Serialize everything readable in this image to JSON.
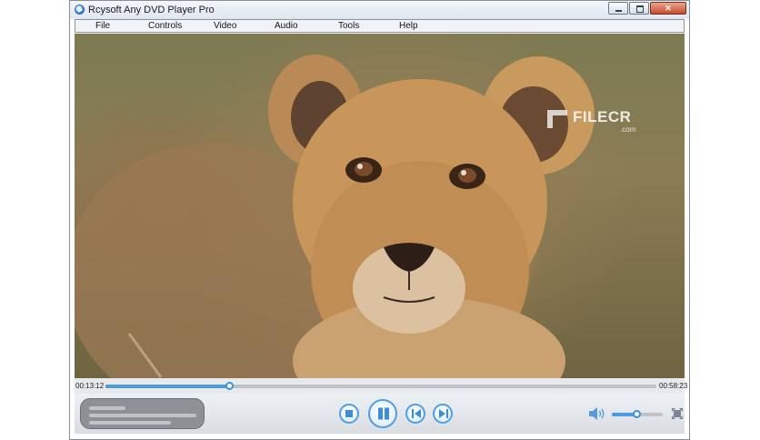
{
  "window": {
    "title": "Rcysoft Any DVD Player Pro"
  },
  "menu": [
    {
      "label": "File"
    },
    {
      "label": "Controls"
    },
    {
      "label": "Video"
    },
    {
      "label": "Audio"
    },
    {
      "label": "Tools"
    },
    {
      "label": "Help"
    }
  ],
  "video": {
    "watermark_brand": "FILECR",
    "watermark_domain": ".com"
  },
  "playback": {
    "elapsed": "00:13:12",
    "total": "00:58:23",
    "progress_fraction": 0.2261,
    "volume_fraction": 0.5
  },
  "icons": {
    "app": "dvd-player-icon",
    "stop": "stop-icon",
    "pause": "pause-icon",
    "previous": "previous-chapter-icon",
    "next": "next-chapter-icon",
    "volume": "speaker-icon",
    "fullscreen": "fullscreen-icon"
  },
  "colors": {
    "accent": "#3b8ddb",
    "progress_fill": "#4a9be0",
    "close_button": "#c94a2d"
  }
}
